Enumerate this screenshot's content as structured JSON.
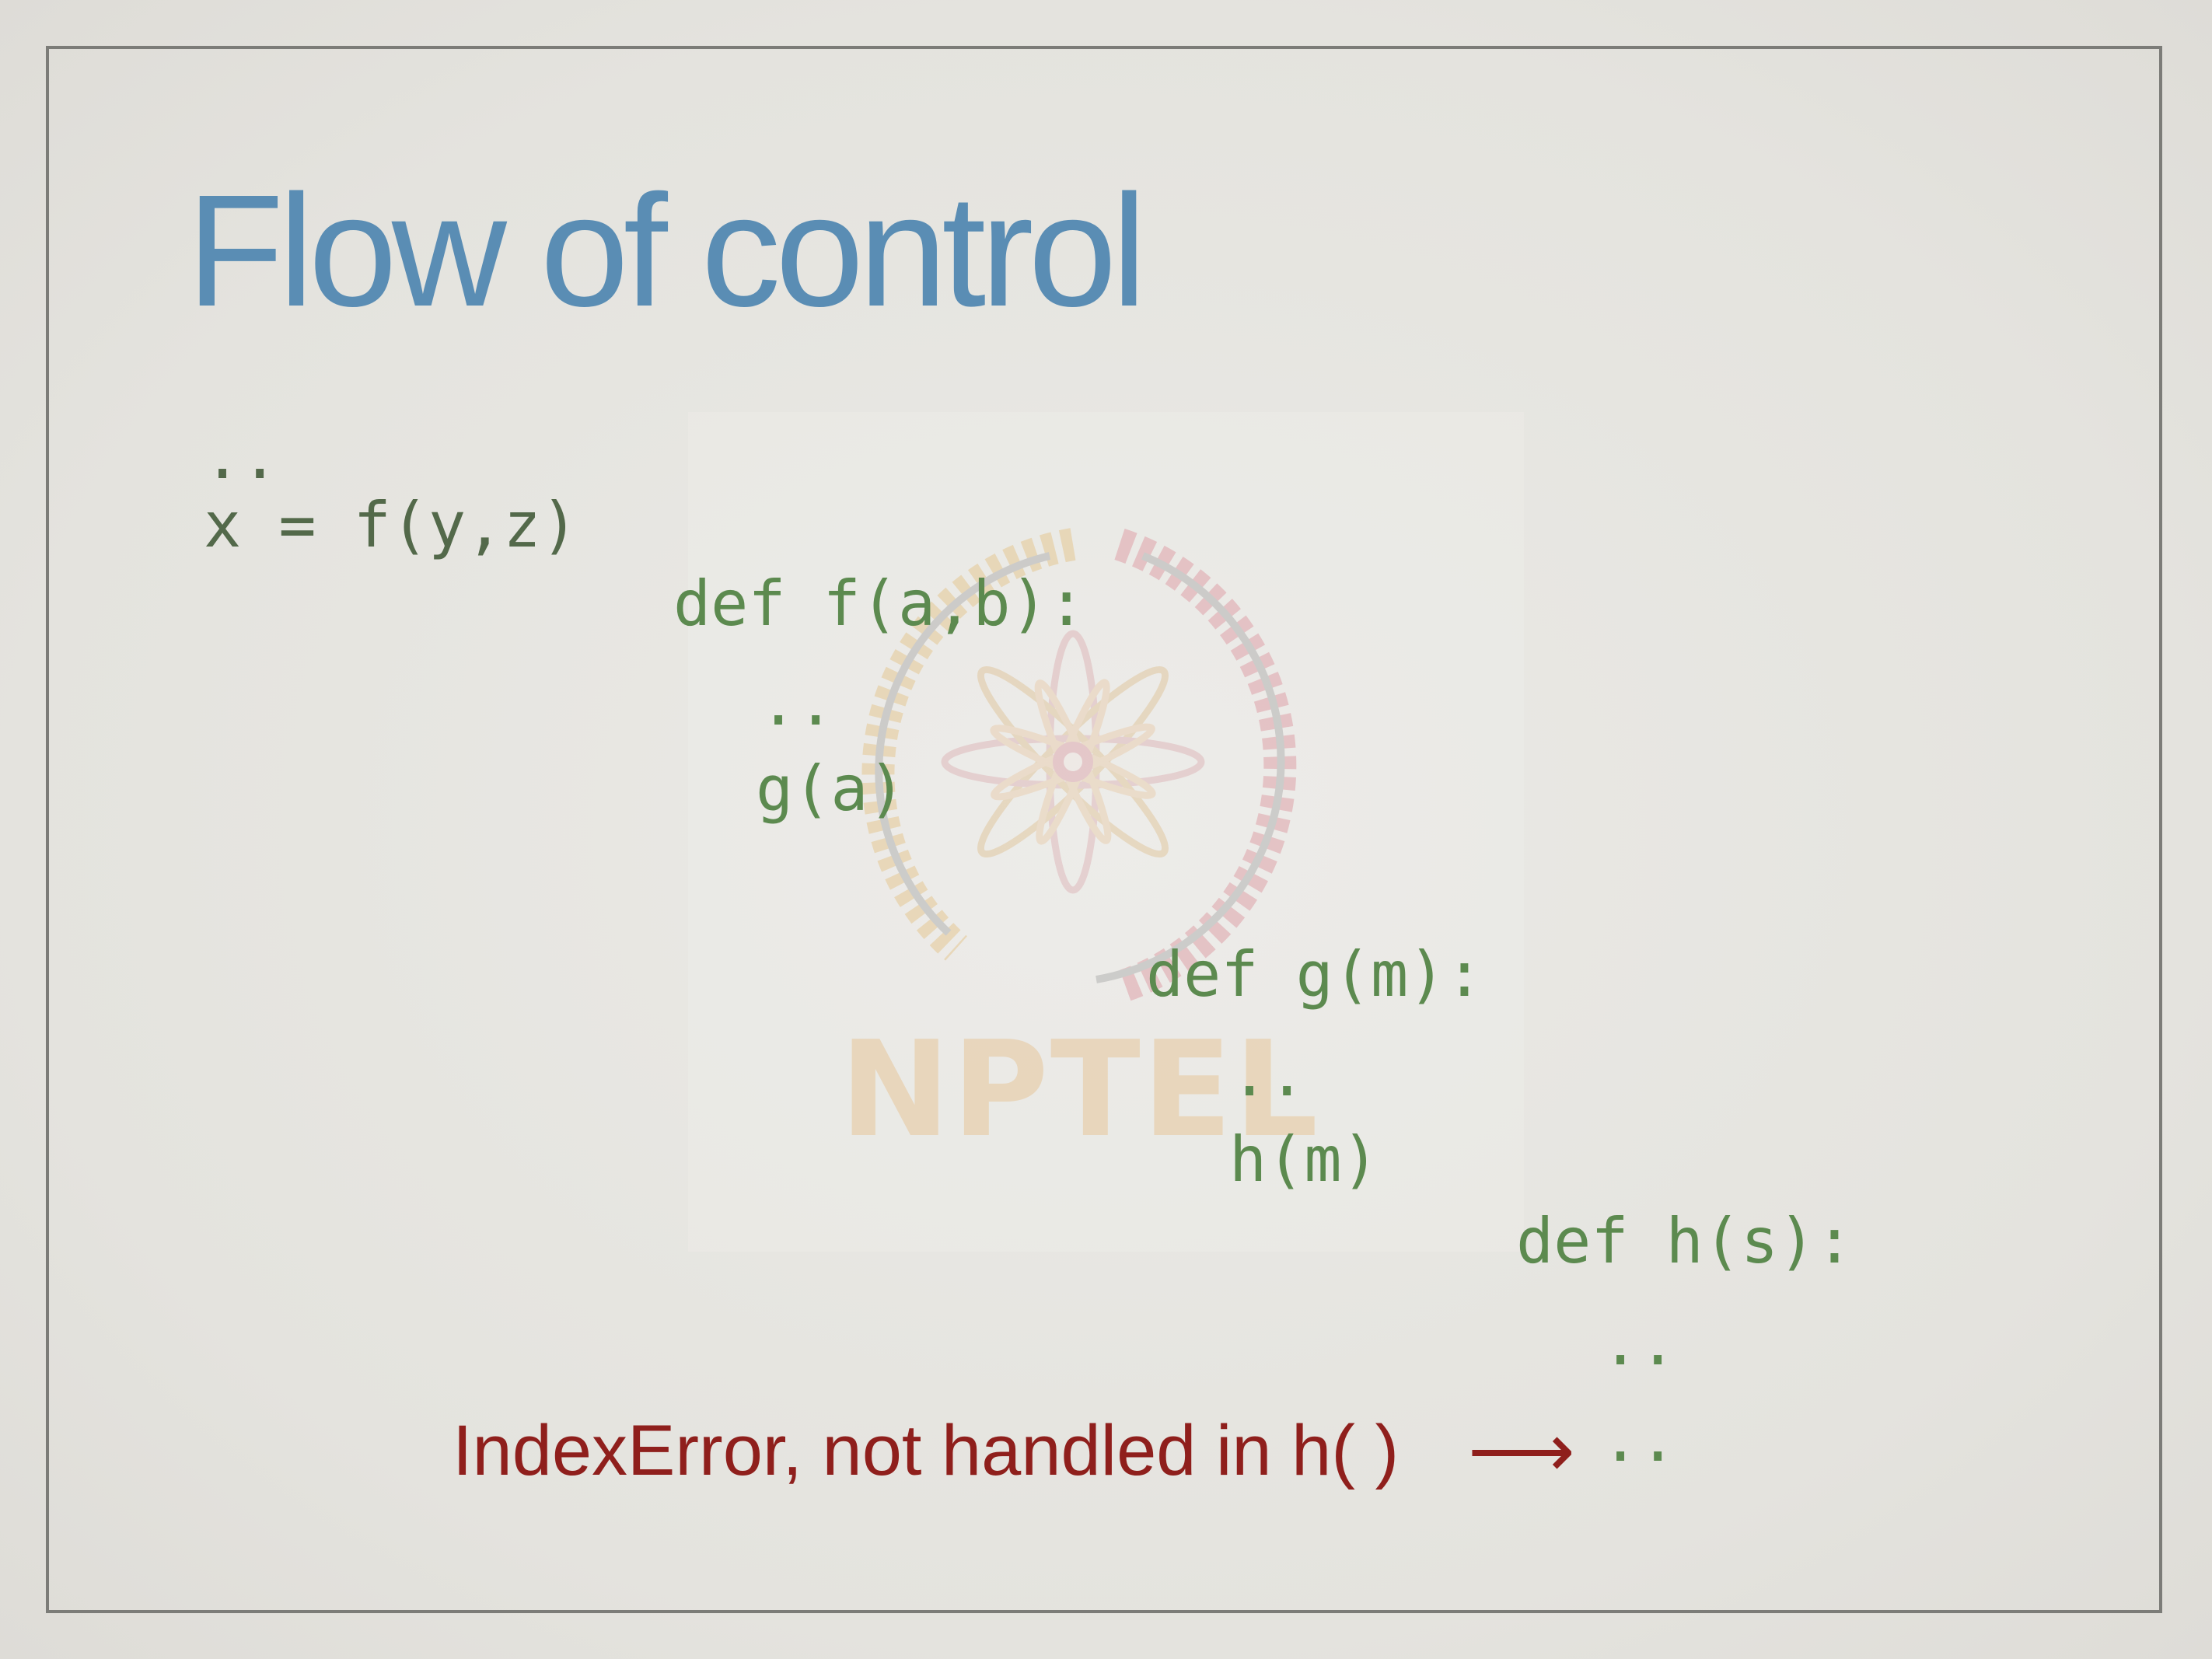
{
  "slide": {
    "title": "Flow of control",
    "watermark": {
      "icon": "nptel-logo-icon",
      "text": "NPTEL"
    },
    "code_lines": [
      {
        "text": "..",
        "style": "dark"
      },
      {
        "text": "x = f(y,z)",
        "style": "dark"
      },
      {
        "text": "def f(a,b):",
        "style": "green"
      },
      {
        "text": "..",
        "style": "green"
      },
      {
        "text": "g(a)",
        "style": "green"
      },
      {
        "text": "def g(m):",
        "style": "green"
      },
      {
        "text": "..",
        "style": "green"
      },
      {
        "text": "h(m)",
        "style": "green"
      },
      {
        "text": "def h(s):",
        "style": "green"
      },
      {
        "text": "..",
        "style": "green"
      },
      {
        "text": "..",
        "style": "green"
      }
    ],
    "error_message": "IndexError, not handled in h( )",
    "arrow_glyph": "⟶",
    "colors": {
      "title": "#5a8db4",
      "code_caller": "#53694a",
      "code_callee": "#5c8a4f",
      "error": "#8f1f1c"
    }
  }
}
